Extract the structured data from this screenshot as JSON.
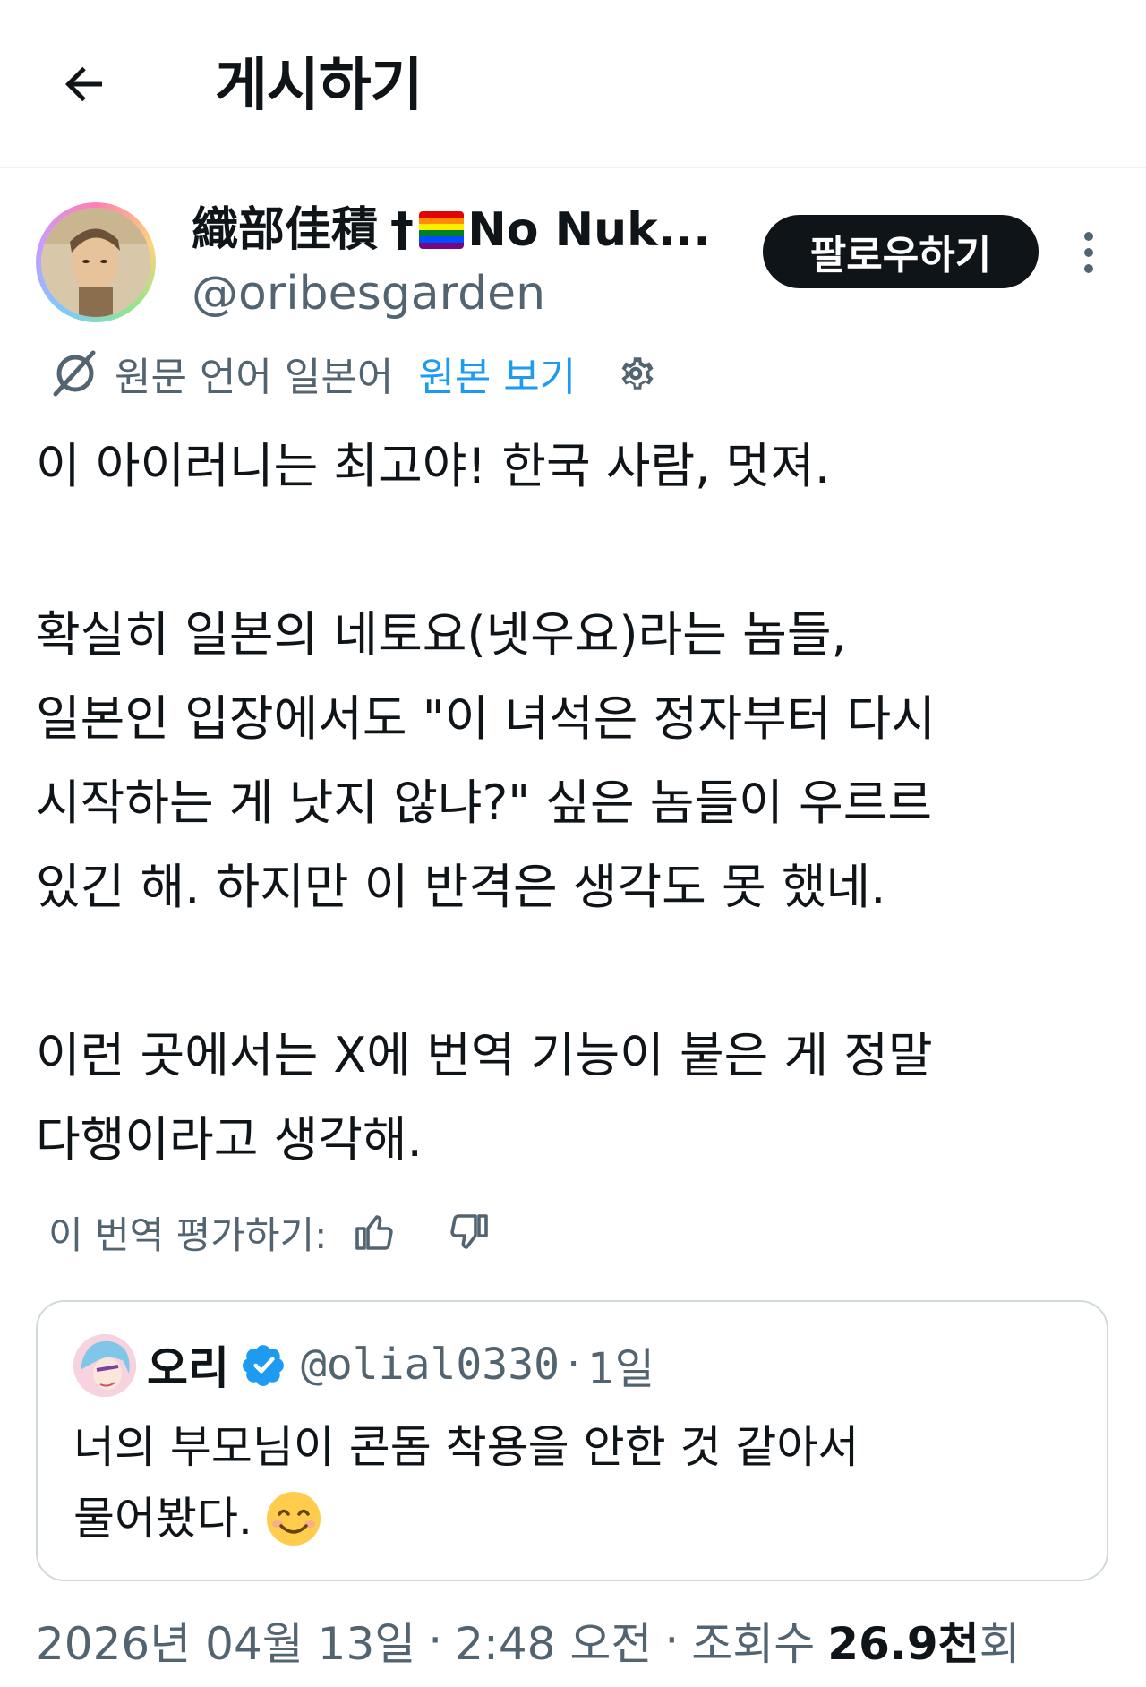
{
  "header": {
    "title": "게시하기",
    "back_icon": "arrow-left-icon"
  },
  "author": {
    "display_name_jp": "織部佳積",
    "display_name_dagger": "†",
    "display_name_rest": "No Nuk...",
    "flag_icon": "rainbow-flag-icon",
    "username": "@oribesgarden",
    "follow_label": "팔로우하기",
    "more_icon": "more-vertical-icon"
  },
  "translation": {
    "label": "원문 언어 일본어",
    "show_original": "원본 보기",
    "settings_icon": "gear-icon"
  },
  "post": {
    "paragraphs": [
      [
        "이 아이러니는 최고야! 한국 사람, 멋져."
      ],
      [
        "확실히 일본의 네토요(넷우요)라는 놈들,",
        "일본인 입장에서도 \"이 녀석은 정자부터 다시",
        "시작하는 게 낫지 않냐?\" 싶은 놈들이 우르르",
        "있긴 해. 하지만 이 반격은 생각도 못 했네."
      ],
      [
        "이런 곳에서는 X에 번역 기능이 붙은 게 정말",
        "다행이라고 생각해."
      ]
    ]
  },
  "rating": {
    "label": "이 번역 평가하기:",
    "thumb_up_icon": "thumbs-up-icon",
    "thumb_down_icon": "thumbs-down-icon"
  },
  "quote": {
    "name": "오리",
    "verified_icon": "verified-badge-icon",
    "handle": "@olial0330",
    "separator": "·",
    "time": "1일",
    "lines": [
      "너의 부모님이 콘돔 착용을 안한 것 같아서",
      "물어봤다."
    ],
    "emoji": "😊"
  },
  "meta": {
    "date": "2026년 04월 13일",
    "sep1": "·",
    "time": "2:48 오전",
    "sep2": "·",
    "views_label": "조회수",
    "views_count": "26.9천",
    "views_suffix": "회"
  },
  "colors": {
    "text": "#0f1419",
    "secondary": "#536471",
    "accent": "#1d9bf0",
    "border": "#cfd9de"
  }
}
